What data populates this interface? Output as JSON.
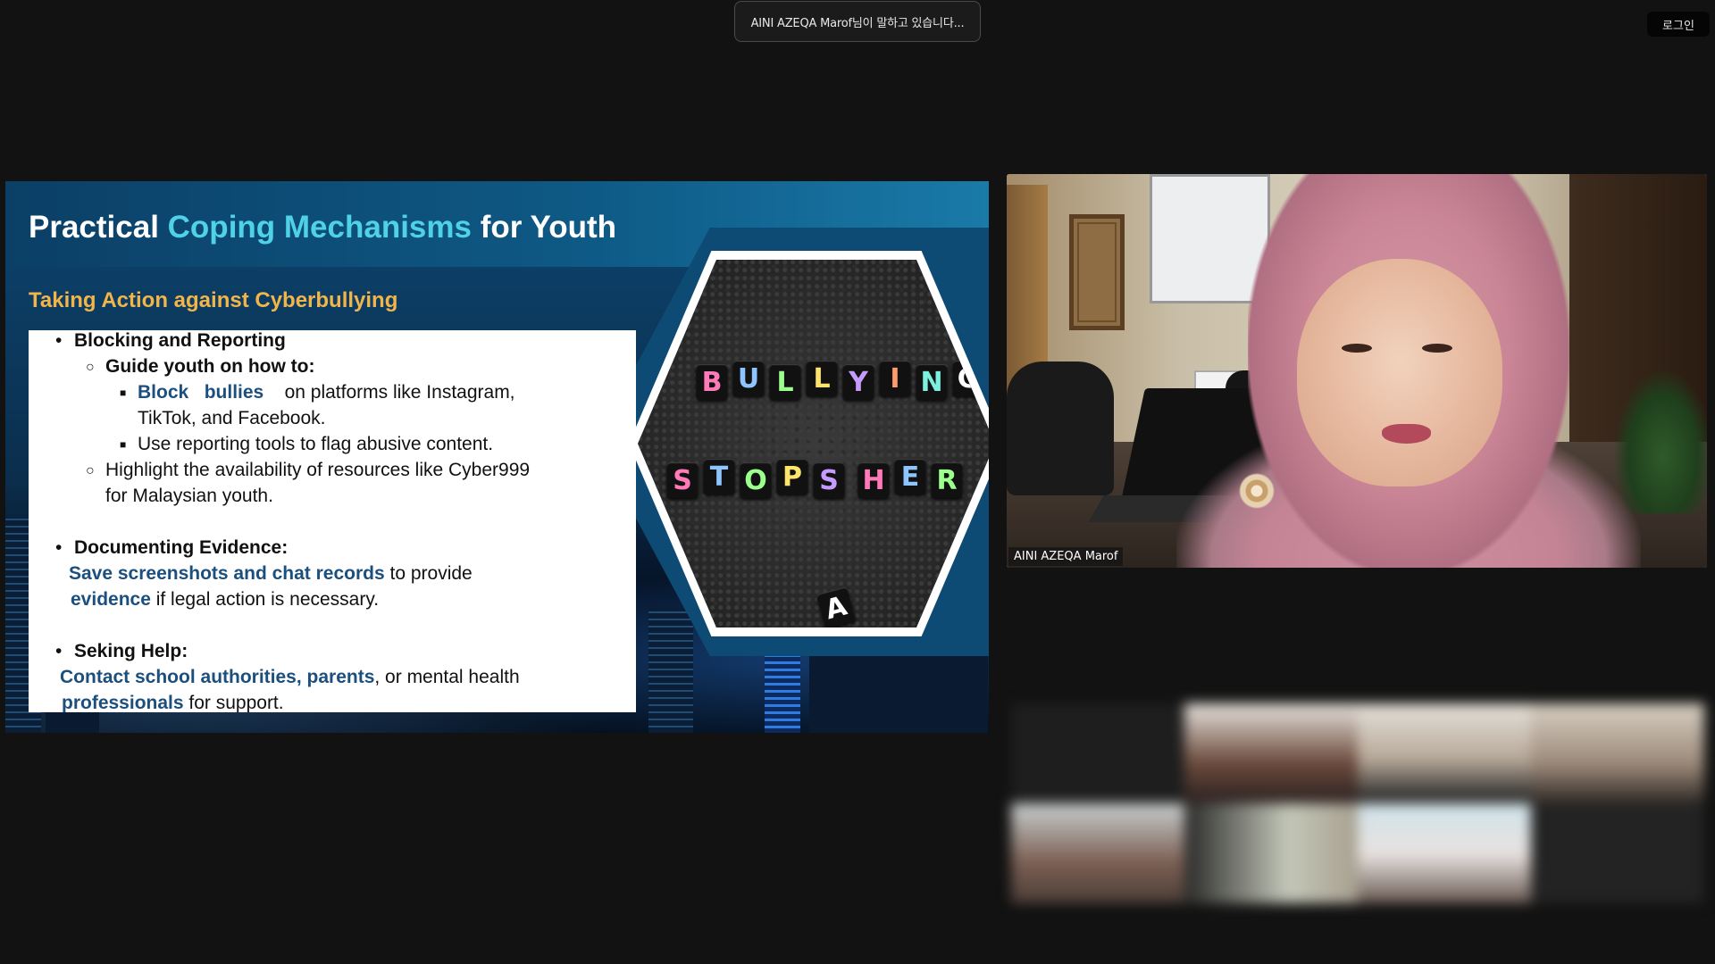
{
  "top_bar": {
    "speaking_indicator": "AINI AZEQA Marof님이 말하고 있습니다...",
    "login_label": "로그인"
  },
  "slide": {
    "title_part1": "Practical ",
    "title_accent": "Coping Mechanisms",
    "title_part2": " for Youth",
    "subtitle": "Taking Action against Cyberbullying",
    "sections": {
      "blocking": {
        "heading": "Blocking and Reporting",
        "guide": "Guide youth on how to:",
        "item1_hl1": "Block",
        "item1_hl2": "bullies",
        "item1_rest": "on  platforms  like  Instagram,",
        "item1_line2": "TikTok, and Facebook.",
        "item2": "Use reporting tools to flag abusive content.",
        "resources_line1": "Highlight the availability of resources like Cyber999",
        "resources_line2": "for Malaysian youth."
      },
      "documenting": {
        "heading": "Documenting Evidence:",
        "line1_hl": "Save screenshots and chat records",
        "line1_rest": " to provide",
        "line2_hl": "evidence",
        "line2_rest": " if legal action is necessary."
      },
      "help": {
        "heading": "Seking Help:",
        "line1_hl": "Contact school authorities, parents",
        "line1_rest": ", or mental health",
        "line2_hl": "professionals",
        "line2_rest": " for support."
      }
    },
    "image_tiles": {
      "row1": [
        "B",
        "U",
        "L",
        "L",
        "Y",
        "I",
        "N",
        "G"
      ],
      "row2": [
        "S",
        "T",
        "O",
        "P",
        "S"
      ],
      "row3": [
        "H",
        "E",
        "R"
      ],
      "stray": "A"
    },
    "colors": {
      "accent": "#4fd1e8",
      "subtitle": "#f2b54a",
      "highlight": "#1b4f7e"
    }
  },
  "speaker_video": {
    "name": "AINI AZEQA Marof"
  }
}
